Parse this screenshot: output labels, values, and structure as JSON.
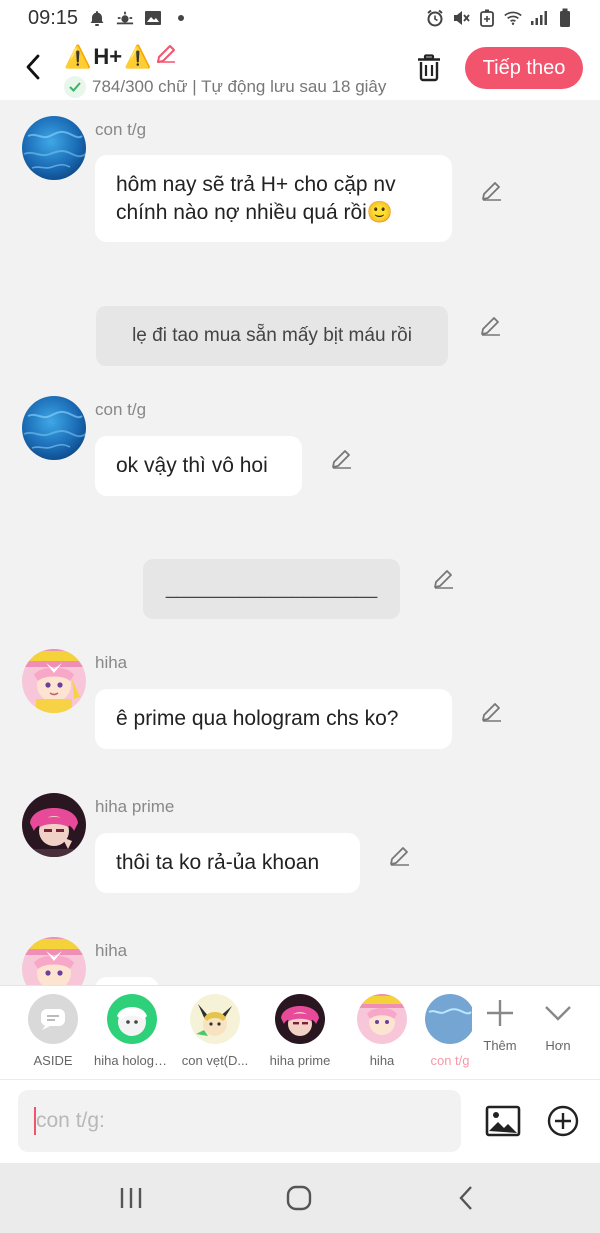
{
  "status_bar": {
    "time": "09:15",
    "left_icons": [
      "bell-icon",
      "weather-icon",
      "gallery-icon",
      "dot-icon"
    ],
    "right_icons": [
      "alarm-icon",
      "mute-icon",
      "battery-saver-icon",
      "wifi-icon",
      "signal-icon",
      "battery-icon"
    ]
  },
  "header": {
    "back_icon": "chevron-left-icon",
    "title_warning_1": "⚠️",
    "title_text": "H+",
    "title_warning_2": "⚠️",
    "title_edit_icon": "pencil-icon",
    "subtitle_check_icon": "check-icon",
    "subtitle": "784/300 chữ | Tự động lưu sau 18 giây",
    "delete_icon": "trash-icon",
    "next_label": "Tiếp theo",
    "accent_color": "#f2546e"
  },
  "messages": [
    {
      "type": "character",
      "sender": "con t/g",
      "text": "hôm nay sẽ trả H+ cho cặp nv chính nào nợ nhiều quá rồi🙂"
    },
    {
      "type": "aside",
      "text": "lẹ đi tao mua sẵn mấy bịt máu rồi"
    },
    {
      "type": "character",
      "sender": "con t/g",
      "text": "ok vậy thì vô hoi"
    },
    {
      "type": "aside",
      "text": "____________________"
    },
    {
      "type": "character",
      "sender": "hiha",
      "text": "ê prime qua hologram chs ko?"
    },
    {
      "type": "character",
      "sender": "hiha prime",
      "text": "thôi ta ko rả-ủa khoan"
    },
    {
      "type": "character",
      "sender": "hiha",
      "text": ""
    }
  ],
  "character_bar": {
    "items": [
      {
        "label": "ASIDE"
      },
      {
        "label": "hiha hologram"
      },
      {
        "label": "con vẹt(D..."
      },
      {
        "label": "hiha prime"
      },
      {
        "label": "hiha"
      },
      {
        "label": "con t/g"
      }
    ],
    "add_label": "Thêm",
    "more_label": "Hơn"
  },
  "input": {
    "placeholder": "con t/g:",
    "image_icon": "image-icon",
    "add_icon": "plus-circle-icon"
  },
  "nav_bar": {
    "icons": [
      "recent-apps-icon",
      "home-icon",
      "back-icon"
    ]
  }
}
